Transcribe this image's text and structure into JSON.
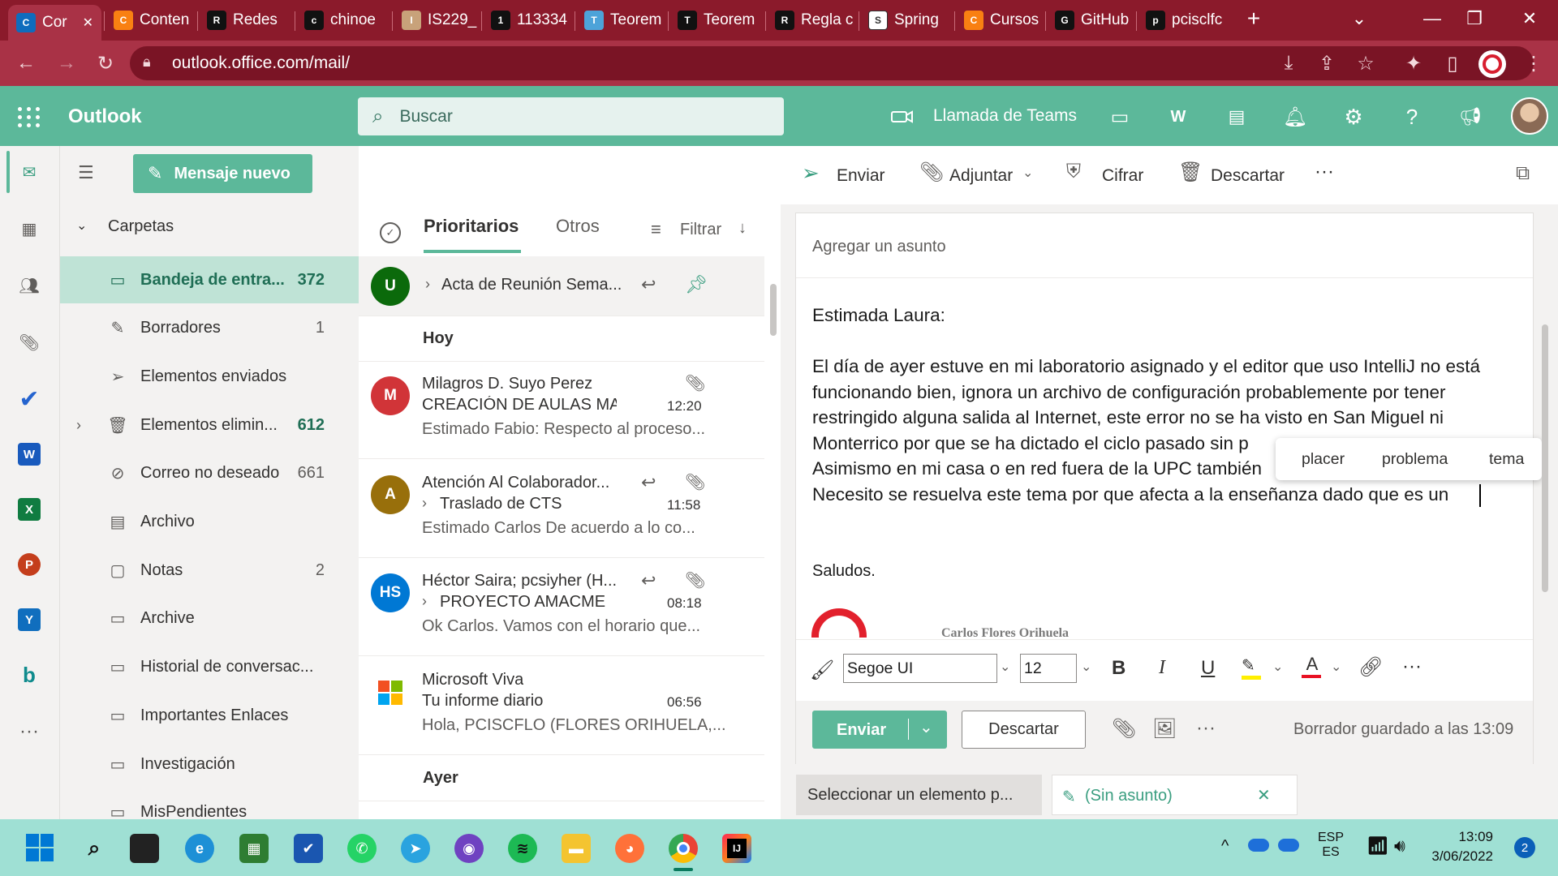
{
  "browser": {
    "tabs": [
      {
        "title": "Cor",
        "icon": "outlook-icon",
        "color": "#0f6cbd"
      },
      {
        "title": "Conten",
        "icon": "moodle-icon",
        "color": "#f98012"
      },
      {
        "title": "Redes",
        "icon": "opera-icon",
        "color": "#111111"
      },
      {
        "title": "chinoe",
        "icon": "github-icon",
        "color": "#111111"
      },
      {
        "title": "IS229_",
        "icon": "avatar-icon",
        "color": "#c8a27a"
      },
      {
        "title": "113334",
        "icon": "blackboard-icon",
        "color": "#111111"
      },
      {
        "title": "Teorem",
        "icon": "teams-icon",
        "color": "#4da3d9"
      },
      {
        "title": "Teorem",
        "icon": "site-icon",
        "color": "#111111"
      },
      {
        "title": "Regla c",
        "icon": "site-icon",
        "color": "#111111"
      },
      {
        "title": "Spring",
        "icon": "spring-icon",
        "color": "#ffffff"
      },
      {
        "title": "Cursos",
        "icon": "moodle-icon",
        "color": "#f98012"
      },
      {
        "title": "GitHub",
        "icon": "github-icon",
        "color": "#111111"
      },
      {
        "title": "pcisclfc",
        "icon": "github-icon",
        "color": "#111111"
      }
    ],
    "url": "outlook.office.com/mail/"
  },
  "header": {
    "app_title": "Outlook",
    "search_placeholder": "Buscar",
    "teams_call": "Llamada de Teams"
  },
  "new_message_label": "Mensaje nuevo",
  "folders": {
    "section_label": "Carpetas",
    "items": [
      {
        "label": "Bandeja de entra...",
        "count": "372",
        "icon": "inbox-icon"
      },
      {
        "label": "Borradores",
        "count": "1",
        "icon": "draft-icon"
      },
      {
        "label": "Elementos enviados",
        "count": "",
        "icon": "send-icon"
      },
      {
        "label": "Elementos elimin...",
        "count": "612",
        "icon": "trash-icon"
      },
      {
        "label": "Correo no deseado",
        "count": "661",
        "icon": "junk-icon"
      },
      {
        "label": "Archivo",
        "count": "",
        "icon": "archive-icon"
      },
      {
        "label": "Notas",
        "count": "2",
        "icon": "note-icon"
      },
      {
        "label": "Archive",
        "count": "",
        "icon": "folder-icon"
      },
      {
        "label": "Historial de conversac...",
        "count": "",
        "icon": "folder-icon"
      },
      {
        "label": "Importantes Enlaces",
        "count": "",
        "icon": "folder-icon"
      },
      {
        "label": "Investigación",
        "count": "",
        "icon": "folder-icon"
      },
      {
        "label": "MisPendientes",
        "count": "",
        "icon": "folder-icon"
      }
    ]
  },
  "list": {
    "tab_focused": "Prioritarios",
    "tab_other": "Otros",
    "filter_label": "Filtrar",
    "pinned": {
      "avatar": "U",
      "subject": "Acta de Reunión Sema..."
    },
    "group_today": "Hoy",
    "group_yesterday": "Ayer",
    "messages": [
      {
        "avatar": "M",
        "avatar_color": "#d13438",
        "sender": "Milagros D. Suyo Perez",
        "subject": "CREACIÓN DE AULAS MASTE...",
        "time": "12:20",
        "preview": "Estimado Fabio: Respecto al proceso..."
      },
      {
        "avatar": "A",
        "avatar_color": "#986f0b",
        "sender": "Atención Al Colaborador...",
        "subject": "Traslado de CTS",
        "time": "11:58",
        "preview": "Estimado Carlos De acuerdo a lo co..."
      },
      {
        "avatar": "HS",
        "avatar_color": "#0078d4",
        "sender": "Héctor Saira; pcsiyher (H...",
        "subject": "PROYECTO AMACME",
        "time": "08:18",
        "preview": "Ok Carlos. Vamos con el horario que..."
      },
      {
        "avatar": "",
        "avatar_color": "",
        "sender": "Microsoft Viva",
        "subject": "Tu informe diario",
        "time": "06:56",
        "preview": "Hola, PCISCFLO (FLORES ORIHUELA,..."
      }
    ]
  },
  "command_bar": {
    "send": "Enviar",
    "attach": "Adjuntar",
    "encrypt": "Cifrar",
    "discard": "Descartar"
  },
  "compose": {
    "subject_placeholder": "Agregar un asunto",
    "greeting": "Estimada Laura:",
    "body_lines": [
      "El día de ayer estuve en mi laboratorio asignado y el editor que uso IntelliJ no está",
      "funcionando bien, ignora un archivo de configuración probablemente por tener",
      "restringido alguna salida al Internet, este error no se ha visto en San Miguel ni",
      "Monterrico por que se ha dictado el ciclo pasado sin p",
      "Asimismo en mi casa o en red fuera de la UPC también",
      "Necesito se resuelva este tema por que afecta a la enseñanza dado que es un"
    ],
    "closing": "Saludos.",
    "signature_name": "Carlos Flores Orihuela",
    "suggestions": [
      "placer",
      "problema",
      "tema"
    ],
    "font_name": "Segoe UI",
    "font_size": "12",
    "send_button": "Enviar",
    "discard_button": "Descartar",
    "draft_status": "Borrador guardado a las 13:09"
  },
  "bottom_tabs": {
    "select_item": "Seleccionar un elemento p...",
    "draft_tab": "(Sin asunto)"
  },
  "taskbar": {
    "language": "ESP",
    "language_sub": "ES",
    "time": "13:09",
    "date": "3/06/2022",
    "notifications": "2"
  }
}
